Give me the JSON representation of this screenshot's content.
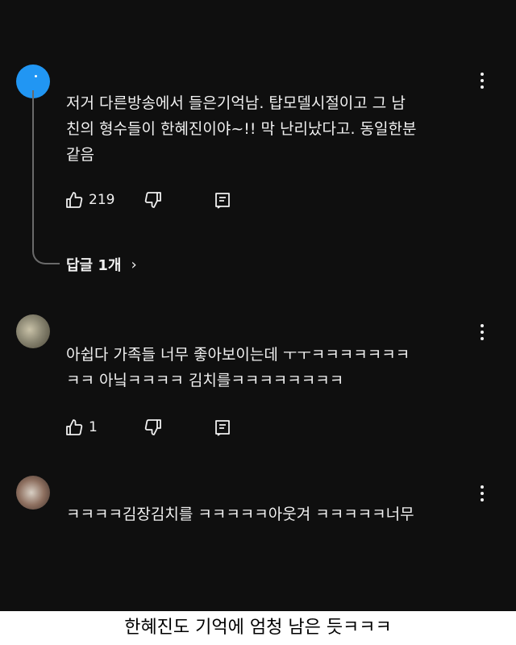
{
  "comments": [
    {
      "text": "저거 다른방송에서 들은기억남. 탑모델시절이고 그 남\n친의 형수들이 한혜진이야~!! 막 난리났다고. 동일한분\n같음",
      "likes": "219"
    },
    {
      "text": "아쉽다 가족들 너무 좋아보이는데 ㅜㅜㅋㅋㅋㅋㅋㅋㅋ\nㅋㅋ 아닠ㅋㅋㅋㅋ 김치를ㅋㅋㅋㅋㅋㅋㅋㅋ",
      "likes": "1"
    },
    {
      "text": "ㅋㅋㅋㅋ김장김치를 ㅋㅋㅋㅋㅋ아웃겨 ㅋㅋㅋㅋㅋ너무"
    }
  ],
  "replies_label": "답글 1개",
  "replies_chevron": "›",
  "caption": "한혜진도 기억에 엄청 남은 듯ㅋㅋㅋ",
  "icons": [
    "like-icon",
    "dislike-icon",
    "reply-icon",
    "more-options-icon",
    "chevron-right-icon"
  ],
  "colors": {
    "background": "#0f0f0f",
    "text": "#f1f1f1",
    "avatar_blue": "#2196f3",
    "caption_bg": "#ffffff"
  }
}
